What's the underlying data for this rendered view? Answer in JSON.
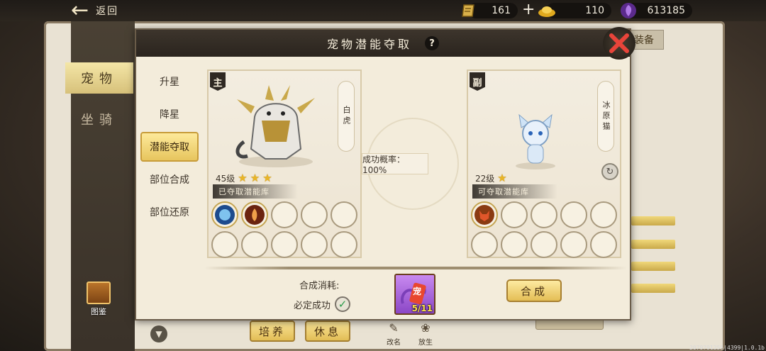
{
  "topbar": {
    "back_label": "返回",
    "resources": [
      {
        "icon": "scroll-ticket-icon",
        "value": "161"
      },
      {
        "icon": "gold-ingot-icon",
        "value": "110"
      },
      {
        "icon": "purple-crystal-icon",
        "value": "613185"
      }
    ],
    "plus_symbol": "+"
  },
  "book": {
    "left_tabs": [
      "宠物",
      "坐骑"
    ],
    "right_tab": "装备",
    "atlas_label": "图鉴",
    "bottom_buttons": [
      "培养",
      "休息"
    ],
    "small_actions": [
      "改名",
      "放生"
    ]
  },
  "modal": {
    "title": "宠物潜能夺取",
    "side_menu": [
      "升星",
      "降星",
      "潜能夺取",
      "部位合成",
      "部位还原"
    ],
    "active_index": 2,
    "main_pet": {
      "role": "主",
      "name": "白虎",
      "level": "45级",
      "stars": 3,
      "banner": "已夺取潜能库"
    },
    "sub_pet": {
      "role": "副",
      "name": "冰原猫",
      "level": "22级",
      "stars": 1,
      "banner": "可夺取潜能库"
    },
    "success_rate": "成功概率：100%",
    "cost_label": "合成消耗:",
    "guarantee_label": "必定成功",
    "item_count": "5/11",
    "item_char": "宠",
    "synth_button": "合成"
  },
  "footer_id": "2079791255|4399|1.0.1b",
  "colors": {
    "accent_gold": "#e7c55e",
    "header_dark": "#2a241e",
    "panel": "#f3ecdb"
  }
}
